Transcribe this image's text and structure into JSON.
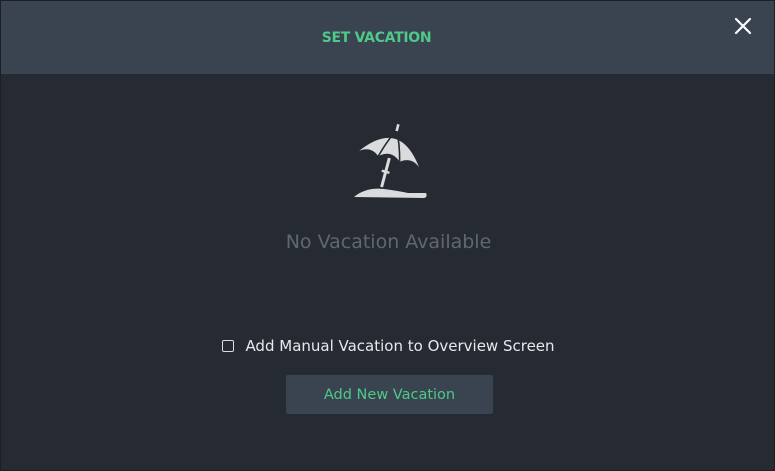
{
  "dialog": {
    "title": "SET VACATION",
    "close_icon": "close-icon",
    "illustration_icon": "beach-umbrella-icon",
    "empty_message": "No Vacation Available",
    "checkbox": {
      "label": "Add Manual Vacation to Overview Screen",
      "checked": false
    },
    "add_button_label": "Add New Vacation"
  },
  "colors": {
    "accent": "#4fc98a",
    "header_bg": "#3a4350",
    "body_bg": "#262b33",
    "muted_text": "#616770"
  }
}
